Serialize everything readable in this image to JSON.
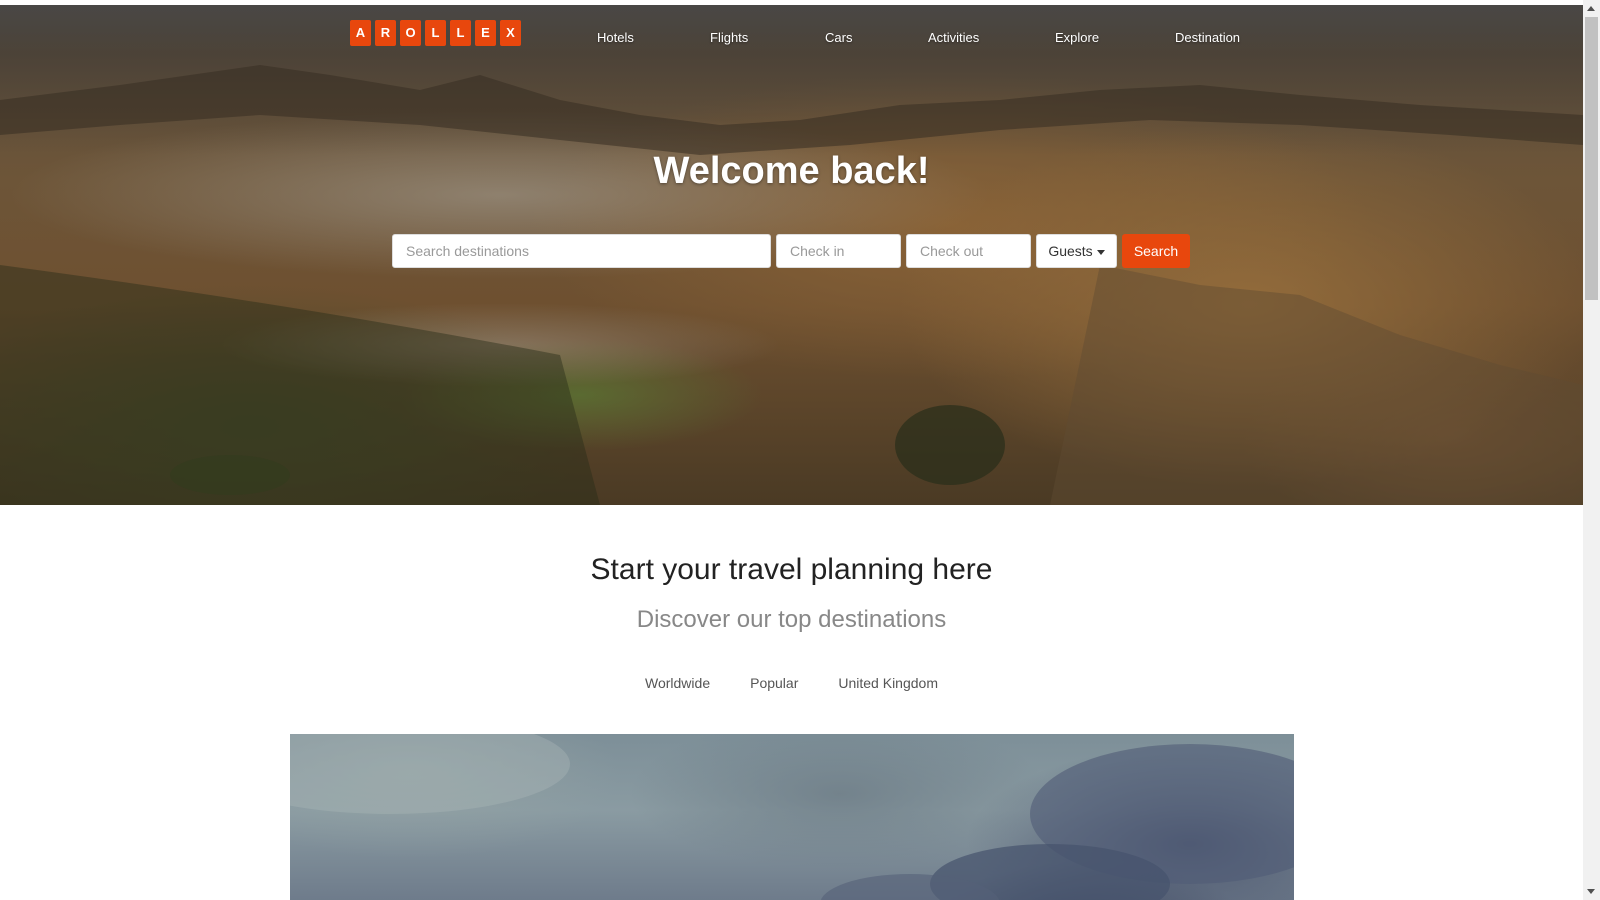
{
  "header": {
    "logo_letters": [
      "A",
      "R",
      "O",
      "L",
      "L",
      "E",
      "X"
    ],
    "nav": [
      {
        "label": "Hotels"
      },
      {
        "label": "Flights"
      },
      {
        "label": "Cars"
      },
      {
        "label": "Activities"
      },
      {
        "label": "Explore"
      },
      {
        "label": "Destination"
      }
    ]
  },
  "hero": {
    "title": "Welcome back!",
    "search": {
      "destination_placeholder": "Search destinations",
      "checkin_placeholder": "Check in",
      "checkout_placeholder": "Check out",
      "guests_label": "Guests",
      "search_label": "Search"
    }
  },
  "main": {
    "title": "Start your travel planning here",
    "subtitle": "Discover our top destinations",
    "tabs": [
      {
        "label": "Worldwide"
      },
      {
        "label": "Popular"
      },
      {
        "label": "United Kingdom"
      }
    ]
  },
  "colors": {
    "accent": "#e8470d"
  }
}
